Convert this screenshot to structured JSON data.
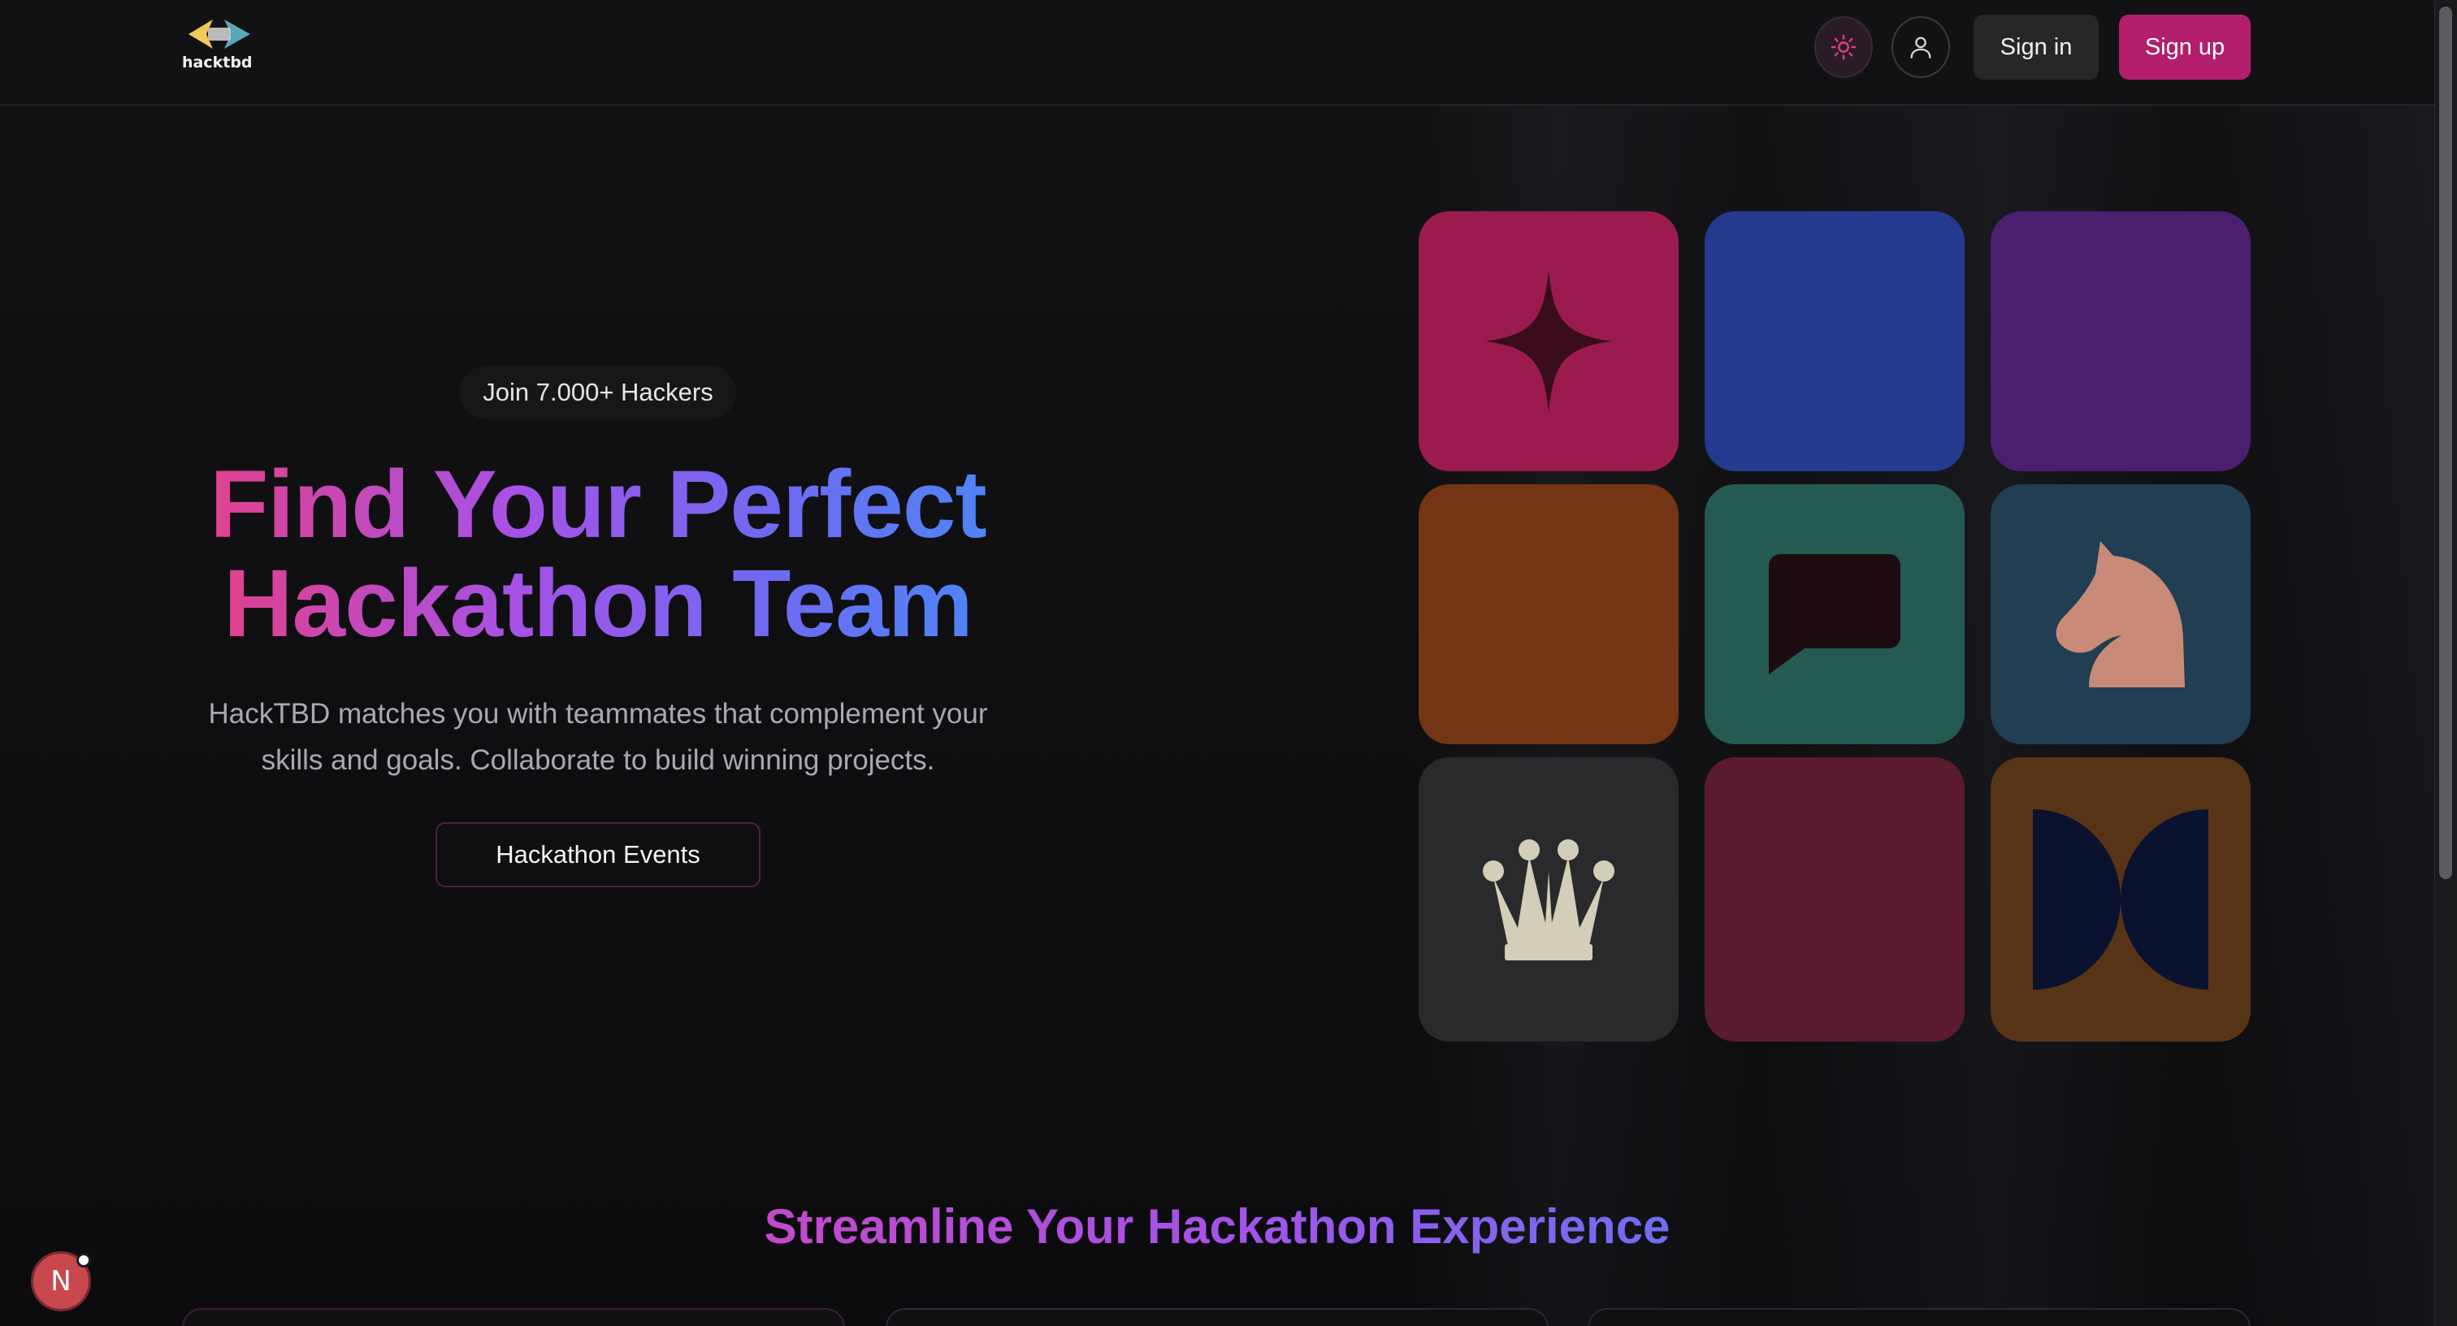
{
  "header": {
    "logo_text": "hacktbd",
    "theme_toggle_icon": "sun-icon",
    "account_icon": "user-icon",
    "signin_label": "Sign in",
    "signup_label": "Sign up"
  },
  "hero": {
    "badge": "Join 7.000+ Hackers",
    "title_line1": "Find Your Perfect",
    "title_line2": "Hackathon Team",
    "subtitle_line1": "HackTBD matches you with teammates that complement your",
    "subtitle_line2": "skills and goals. Collaborate to build winning projects.",
    "cta_label": "Hackathon Events"
  },
  "tiles": [
    {
      "color": "#9c1b4e",
      "icon": "sparkle-icon"
    },
    {
      "color": "#233a8f",
      "icon": ""
    },
    {
      "color": "#4a1f6e",
      "icon": ""
    },
    {
      "color": "#733514",
      "icon": ""
    },
    {
      "color": "#255a52",
      "icon": "chat-bubble-icon"
    },
    {
      "color": "#213e52",
      "icon": "chess-knight-icon"
    },
    {
      "color": "#2a2a2c",
      "icon": "crown-icon"
    },
    {
      "color": "#5a1b2f",
      "icon": ""
    },
    {
      "color": "#583416",
      "icon": "bowtie-shape-icon"
    }
  ],
  "section": {
    "title": "Streamline Your Hackathon Experience"
  },
  "dev_badge": {
    "letter": "N"
  },
  "colors": {
    "accent": "#b21e6c",
    "background": "#0e0e10"
  }
}
